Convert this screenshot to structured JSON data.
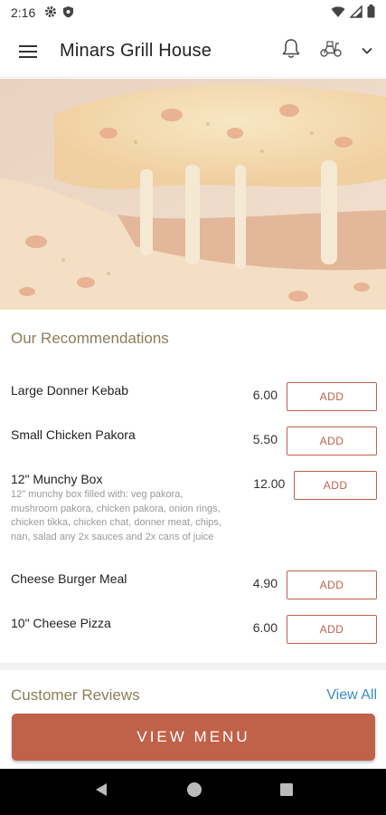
{
  "status_bar": {
    "time": "2:16",
    "left_icons": [
      "gear-icon",
      "shield-icon"
    ],
    "right_icons": [
      "wifi-icon",
      "signal-icon",
      "battery-icon"
    ]
  },
  "app_bar": {
    "title": "Minars Grill House",
    "icons": [
      "menu-icon",
      "bell-icon",
      "scooter-icon",
      "chevron-down-icon"
    ]
  },
  "hero": {
    "image": "cheese-pizza-photo"
  },
  "recommendations": {
    "title": "Our Recommendations",
    "items": [
      {
        "name": "Large Donner Kebab",
        "description": "",
        "price": "6.00",
        "add_label": "ADD"
      },
      {
        "name": "Small Chicken Pakora",
        "description": "",
        "price": "5.50",
        "add_label": "ADD"
      },
      {
        "name": "12\" Munchy Box",
        "description": "12\" munchy box filled with: veg pakora, mushroom pakora, chicken pakora, onion rings, chicken tikka, chicken chat, donner meat, chips, nan, salad any 2x sauces and 2x cans of juice",
        "price": "12.00",
        "add_label": "ADD"
      },
      {
        "name": "Cheese Burger Meal",
        "description": "",
        "price": "4.90",
        "add_label": "ADD"
      },
      {
        "name": "10\" Cheese Pizza",
        "description": "",
        "price": "6.00",
        "add_label": "ADD"
      }
    ]
  },
  "reviews": {
    "title": "Customer Reviews",
    "view_all_label": "View All"
  },
  "view_menu_label": "VIEW MENU",
  "nav_bar": {
    "icons": [
      "back-icon",
      "home-icon",
      "recents-icon"
    ]
  },
  "colors": {
    "accent": "#c0614a",
    "section_title": "#8f7d57",
    "link": "#3b8ac4"
  }
}
